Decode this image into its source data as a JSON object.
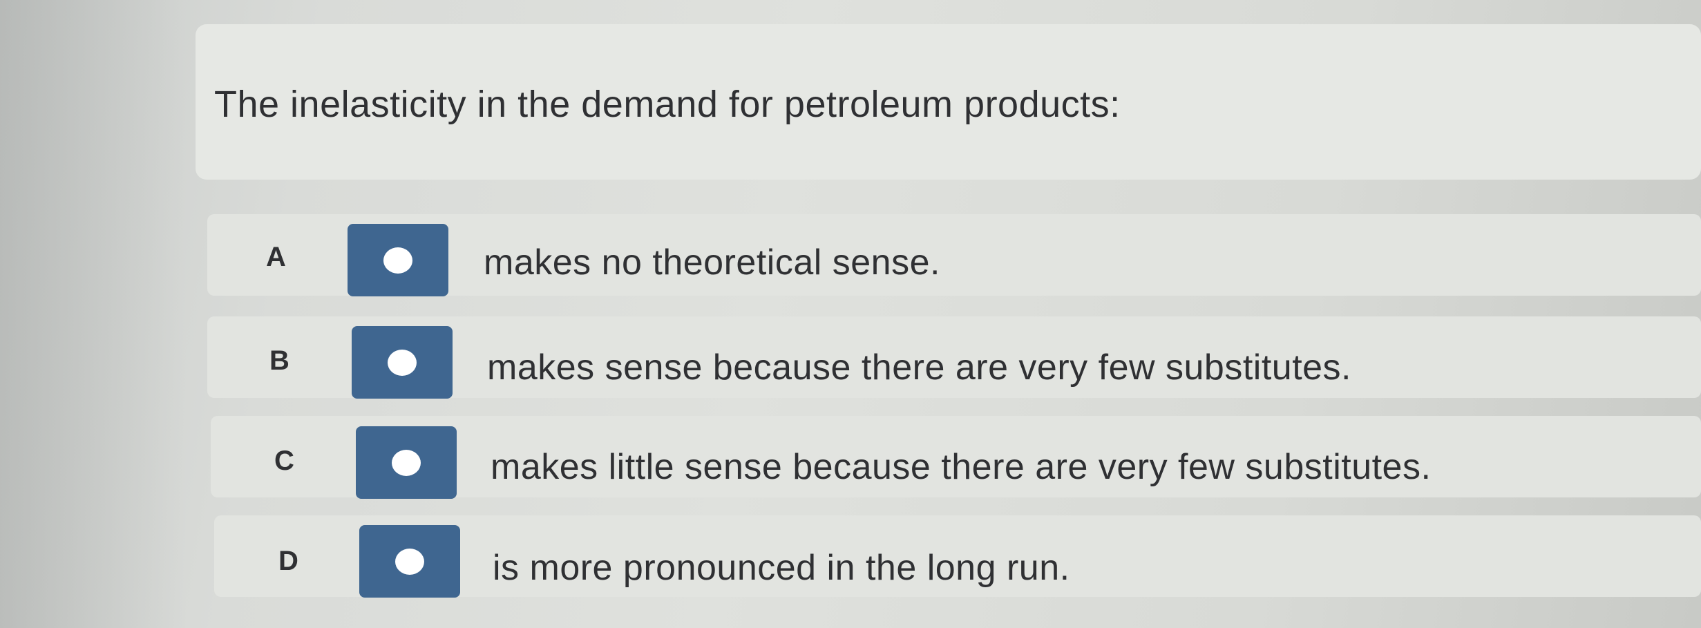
{
  "question": {
    "text": "The inelasticity in the demand for petroleum products:"
  },
  "options": [
    {
      "letter": "A",
      "text": "makes no theoretical sense."
    },
    {
      "letter": "B",
      "text": "makes sense because there are very few substitutes."
    },
    {
      "letter": "C",
      "text": "makes little sense because there are very few substitutes."
    },
    {
      "letter": "D",
      "text": "is more pronounced in the long run."
    }
  ],
  "colors": {
    "radio_fill": "#3f6690",
    "radio_dot": "#ffffff",
    "text": "#2f3033"
  }
}
